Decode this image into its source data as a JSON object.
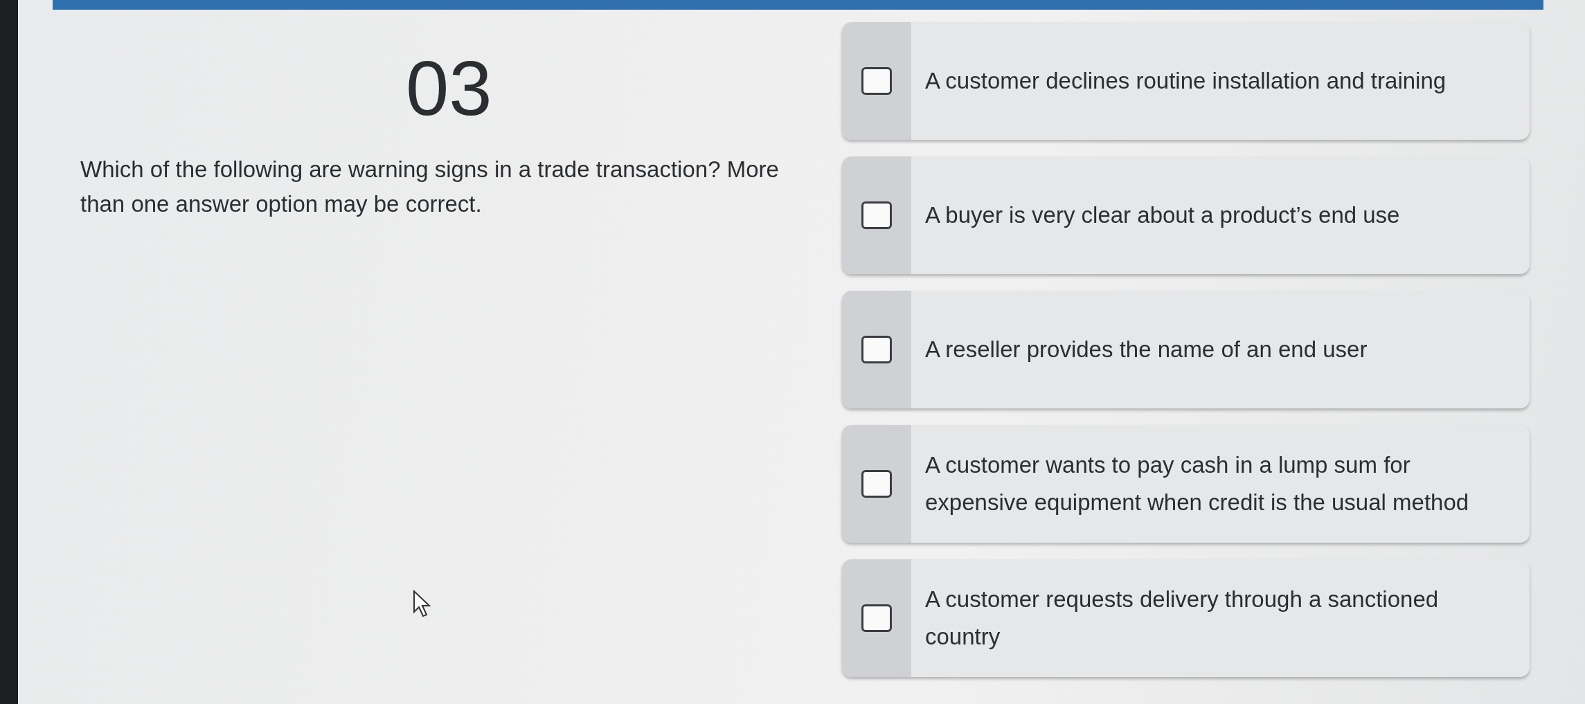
{
  "question": {
    "number": "03",
    "prompt": "Which of the following are warning signs in a trade transaction? More than one answer option may be correct."
  },
  "options": [
    {
      "label": "A customer declines routine installation and training",
      "checked": false
    },
    {
      "label": "A buyer is very clear about a product’s end use",
      "checked": false
    },
    {
      "label": "A reseller provides the name of an end user",
      "checked": false
    },
    {
      "label": "A customer wants to pay cash in a lump sum for expensive equipment when credit is the usual method",
      "checked": false
    },
    {
      "label": "A customer requests delivery through a sanctioned country",
      "checked": false
    }
  ]
}
